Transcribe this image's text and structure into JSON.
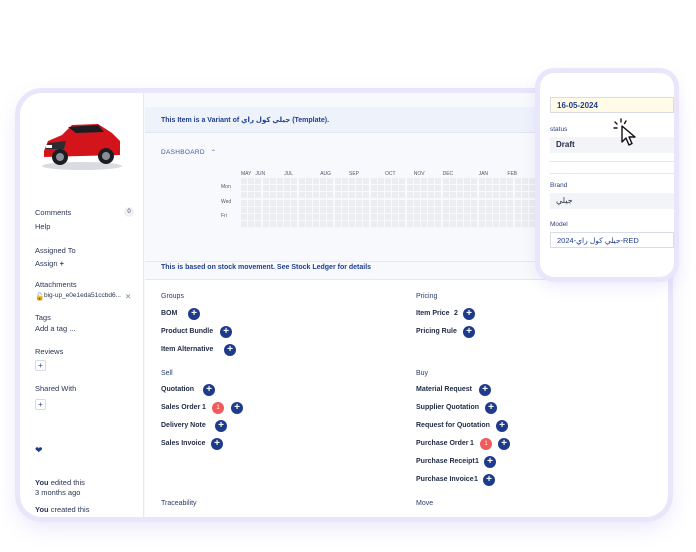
{
  "sidebar": {
    "comments": "Comments",
    "comments_count": "0",
    "help": "Help",
    "assigned_to": "Assigned To",
    "assign": "Assign",
    "attachments": "Attachments",
    "attachment_file": "big-up_e0e1eda51ccbd6...",
    "tags": "Tags",
    "add_tag": "Add a tag ...",
    "reviews": "Reviews",
    "shared_with": "Shared With",
    "activity": [
      {
        "who": "You",
        "action": "edited this",
        "when": "3 months ago"
      },
      {
        "who": "You",
        "action": "created this"
      }
    ]
  },
  "main": {
    "variant_notice": "This Item is a Variant of جيلي كول راي (Template).",
    "dashboard_label": "DASHBOARD",
    "stock_note": "This is based on stock movement. See Stock Ledger for details"
  },
  "heatmap": {
    "months": [
      "MAY",
      "JUN",
      "JUL",
      "AUG",
      "SEP",
      "OCT",
      "NOV",
      "DEC",
      "JAN",
      "FEB",
      "MAR"
    ],
    "days": [
      "Mon",
      "Wed",
      "Fri"
    ],
    "weeks": 48,
    "active": [
      {
        "week": 43,
        "day": 2
      }
    ]
  },
  "connections": {
    "groups_title": "Groups",
    "groups": [
      {
        "label": "BOM"
      },
      {
        "label": "Product Bundle"
      },
      {
        "label": "Item Alternative"
      }
    ],
    "pricing_title": "Pricing",
    "pricing": [
      {
        "label": "Item Price",
        "count": "2"
      },
      {
        "label": "Pricing Rule"
      }
    ],
    "sell_title": "Sell",
    "sell": [
      {
        "label": "Quotation"
      },
      {
        "label": "Sales Order",
        "count": "1",
        "badge": "1"
      },
      {
        "label": "Delivery Note"
      },
      {
        "label": "Sales Invoice"
      }
    ],
    "buy_title": "Buy",
    "buy": [
      {
        "label": "Material Request"
      },
      {
        "label": "Supplier Quotation"
      },
      {
        "label": "Request for Quotation"
      },
      {
        "label": "Purchase Order",
        "count": "1",
        "badge": "1"
      },
      {
        "label": "Purchase Receipt",
        "count": "1"
      },
      {
        "label": "Purchase Invoice",
        "count": "1"
      }
    ],
    "traceability_title": "Traceability",
    "move_title": "Move"
  },
  "popup": {
    "date": "16-05-2024",
    "status_label": "status",
    "status_value": "Draft",
    "brand_label": "Brand",
    "brand_value": "جيلي",
    "model_label": "Model",
    "model_value": "جيلي كول راي-2024-RED"
  },
  "colors": {
    "accent": "#1e3a8a",
    "badge": "#f05a5a",
    "heat_active": "#1e6b2e",
    "frame_glow": "#e9e5fb"
  }
}
